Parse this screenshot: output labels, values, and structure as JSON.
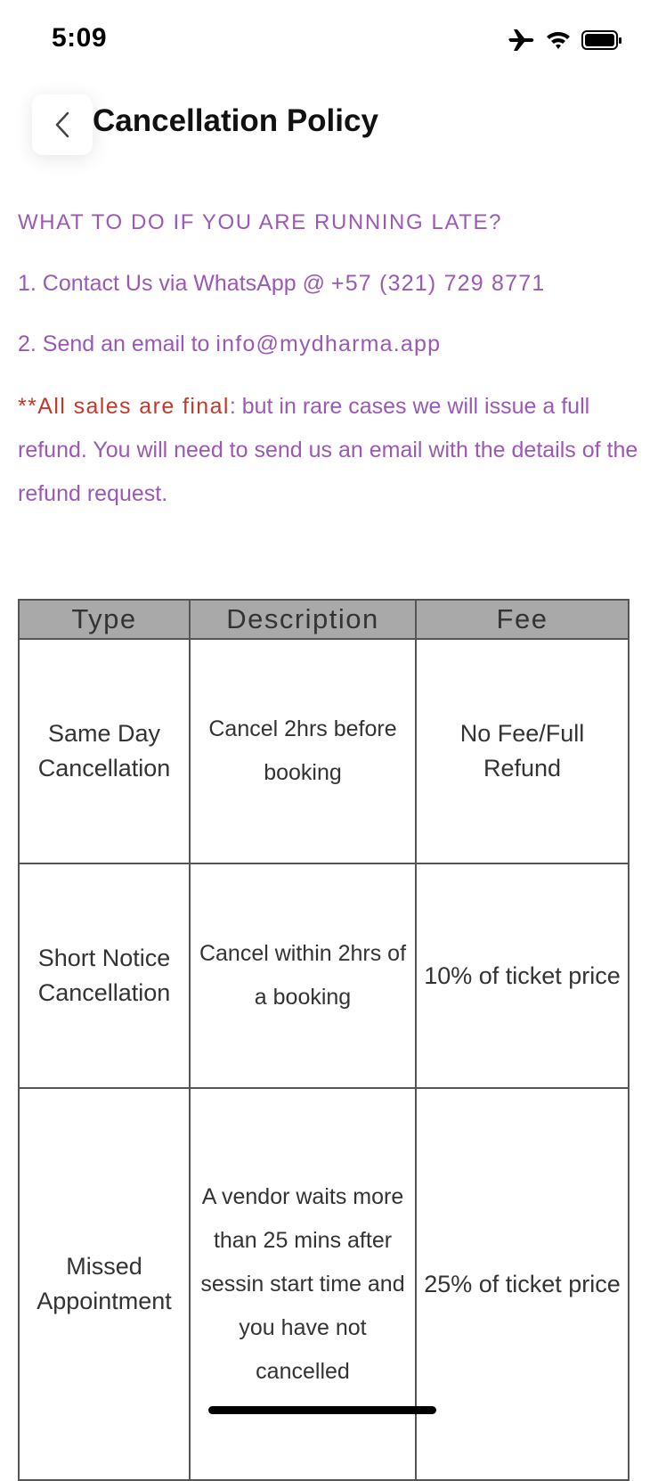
{
  "status_bar": {
    "time": "5:09"
  },
  "header": {
    "title": "Cancellation Policy"
  },
  "policy": {
    "heading": "WHAT TO DO IF YOU ARE RUNNING LATE?",
    "contact_prefix": "1. Contact Us via WhatsApp @ ",
    "contact_phone": "+57 (321) 729 8771",
    "email_prefix": "2. Send an email to ",
    "email": "info@mydharma.app",
    "note_red": "**All sales are final",
    "note_rest": ": but in rare cases we will issue a full refund. You will need to send us an email with the details of the refund request."
  },
  "table": {
    "headers": [
      "Type",
      "Description",
      "Fee"
    ],
    "rows": [
      {
        "type": "Same Day Cancellation",
        "description": "Cancel 2hrs before booking",
        "fee": "No Fee/Full Refund"
      },
      {
        "type": "Short Notice Cancellation",
        "description": "Cancel within 2hrs of a booking",
        "fee": "10% of ticket price"
      },
      {
        "type": "Missed Appointment",
        "description": "A vendor waits more than 25 mins after sessin start time and you have not cancelled",
        "fee": "25% of ticket price"
      }
    ]
  },
  "colors": {
    "accent": "#9b59b6",
    "warning": "#c0392b",
    "table_header": "#a9a9a9"
  },
  "icons": [
    "airplane-icon",
    "wifi-icon",
    "battery-icon",
    "chevron-left-icon"
  ]
}
